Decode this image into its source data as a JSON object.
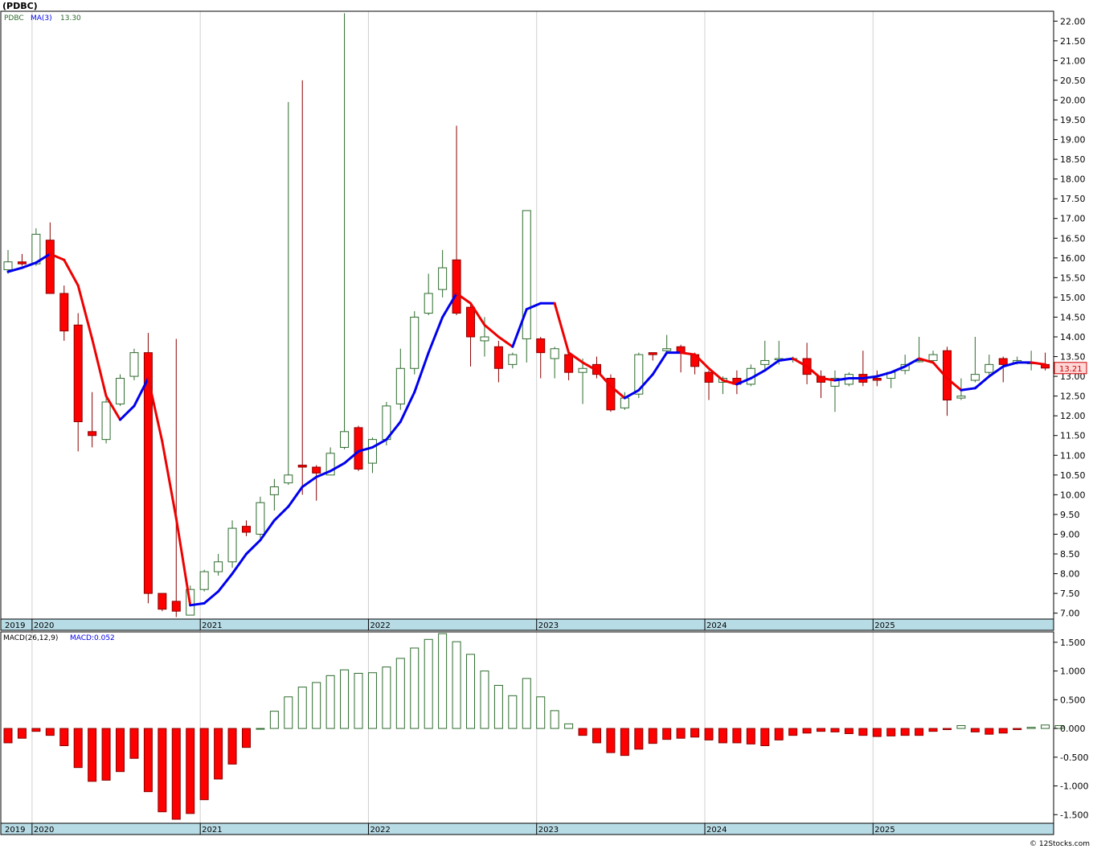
{
  "header": {
    "title": "(PDBC)",
    "symbol_label": "PDBC",
    "ma_label": "MA(3)",
    "ma_value": "13.30",
    "macd_label": "MACD(26,12,9)",
    "macd_value_label": "MACD:0.052",
    "last_price_tag": "13.21",
    "watermark": "© 12Stocks.com"
  },
  "colors": {
    "up_candle_edge": "#2e6b2e",
    "down_candle": "#ff0000",
    "ma_up": "#0000ee",
    "ma_down": "#ee0000",
    "macd_pos": "#2e6b2e",
    "macd_neg": "#ff0000",
    "axis_strip": "#b8dce6",
    "grid": "#d0d0d0"
  },
  "chart_data": [
    {
      "type": "candlestick",
      "name": "price",
      "interval": "monthly",
      "start": "2019-11",
      "ylim": [
        6.85,
        22.25
      ],
      "y_ticks": [
        "7.00",
        "7.50",
        "8.00",
        "8.50",
        "9.00",
        "9.50",
        "10.00",
        "10.50",
        "11.00",
        "11.50",
        "12.00",
        "12.50",
        "13.00",
        "13.50",
        "14.00",
        "14.50",
        "15.00",
        "15.50",
        "16.00",
        "16.50",
        "17.00",
        "17.50",
        "18.00",
        "18.50",
        "19.00",
        "19.50",
        "20.00",
        "20.50",
        "21.00",
        "21.50",
        "22.00"
      ],
      "x_labels": [
        "2019",
        "2020",
        "2021",
        "2022",
        "2023",
        "2024",
        "2025"
      ],
      "ohlc": [
        [
          15.7,
          16.2,
          15.6,
          15.9
        ],
        [
          15.9,
          16.1,
          15.8,
          15.85
        ],
        [
          15.85,
          16.75,
          15.8,
          16.6
        ],
        [
          16.45,
          16.9,
          15.1,
          15.1
        ],
        [
          15.1,
          15.3,
          13.9,
          14.15
        ],
        [
          14.3,
          14.6,
          11.1,
          11.85
        ],
        [
          11.6,
          12.6,
          11.2,
          11.5
        ],
        [
          11.4,
          12.45,
          11.3,
          12.35
        ],
        [
          12.3,
          13.05,
          12.25,
          12.95
        ],
        [
          13.0,
          13.7,
          12.9,
          13.6
        ],
        [
          13.6,
          14.1,
          7.25,
          7.5
        ],
        [
          7.5,
          7.5,
          7.05,
          7.1
        ],
        [
          7.3,
          13.95,
          6.9,
          7.05
        ],
        [
          6.95,
          7.7,
          6.95,
          7.6
        ],
        [
          7.6,
          8.1,
          7.55,
          8.05
        ],
        [
          8.05,
          8.5,
          7.95,
          8.3
        ],
        [
          8.3,
          9.35,
          8.15,
          9.15
        ],
        [
          9.2,
          9.35,
          8.95,
          9.05
        ],
        [
          9.0,
          9.95,
          8.9,
          9.8
        ],
        [
          10.0,
          10.4,
          9.6,
          10.2
        ],
        [
          10.3,
          19.95,
          10.25,
          10.5
        ],
        [
          10.75,
          20.5,
          10.0,
          10.7
        ],
        [
          10.7,
          10.75,
          9.85,
          10.55
        ],
        [
          10.5,
          11.2,
          10.5,
          11.05
        ],
        [
          11.2,
          22.2,
          11.15,
          11.6
        ],
        [
          11.7,
          11.75,
          10.6,
          10.65
        ],
        [
          10.8,
          11.45,
          10.55,
          11.4
        ],
        [
          11.4,
          12.35,
          11.25,
          12.25
        ],
        [
          12.3,
          13.7,
          12.15,
          13.2
        ],
        [
          13.2,
          14.65,
          13.05,
          14.5
        ],
        [
          14.6,
          15.6,
          14.55,
          15.1
        ],
        [
          15.2,
          16.2,
          15.0,
          15.75
        ],
        [
          15.95,
          19.35,
          14.55,
          14.6
        ],
        [
          14.75,
          14.85,
          13.25,
          14.0
        ],
        [
          13.9,
          14.5,
          13.5,
          14.0
        ],
        [
          13.75,
          13.9,
          12.85,
          13.2
        ],
        [
          13.3,
          13.6,
          13.2,
          13.55
        ],
        [
          13.95,
          17.2,
          13.35,
          17.2
        ],
        [
          13.95,
          14.0,
          12.95,
          13.6
        ],
        [
          13.45,
          13.75,
          12.95,
          13.7
        ],
        [
          13.55,
          13.6,
          12.9,
          13.1
        ],
        [
          13.1,
          13.45,
          12.3,
          13.2
        ],
        [
          13.3,
          13.5,
          12.95,
          13.05
        ],
        [
          12.95,
          13.05,
          12.1,
          12.15
        ],
        [
          12.2,
          12.6,
          12.15,
          12.45
        ],
        [
          12.55,
          13.6,
          12.45,
          13.55
        ],
        [
          13.6,
          13.6,
          13.4,
          13.55
        ],
        [
          13.65,
          14.05,
          13.55,
          13.7
        ],
        [
          13.75,
          13.8,
          13.1,
          13.6
        ],
        [
          13.55,
          13.6,
          13.05,
          13.25
        ],
        [
          13.1,
          13.15,
          12.4,
          12.85
        ],
        [
          12.85,
          13.0,
          12.55,
          12.95
        ],
        [
          12.95,
          13.15,
          12.55,
          12.8
        ],
        [
          12.8,
          13.3,
          12.75,
          13.2
        ],
        [
          13.3,
          13.9,
          13.15,
          13.4
        ],
        [
          13.45,
          13.9,
          13.3,
          13.45
        ],
        [
          13.45,
          13.5,
          13.35,
          13.45
        ],
        [
          13.45,
          13.85,
          12.8,
          13.05
        ],
        [
          13.0,
          13.15,
          12.45,
          12.85
        ],
        [
          12.75,
          13.15,
          12.1,
          12.95
        ],
        [
          12.8,
          13.1,
          12.75,
          13.05
        ],
        [
          13.05,
          13.65,
          12.75,
          12.85
        ],
        [
          12.95,
          13.15,
          12.75,
          12.9
        ],
        [
          12.95,
          13.1,
          12.7,
          13.1
        ],
        [
          13.15,
          13.55,
          13.05,
          13.3
        ],
        [
          13.4,
          14.0,
          13.35,
          13.4
        ],
        [
          13.4,
          13.65,
          13.35,
          13.55
        ],
        [
          13.65,
          13.75,
          12.0,
          12.4
        ],
        [
          12.45,
          12.95,
          12.4,
          12.5
        ],
        [
          12.9,
          14.0,
          12.85,
          13.05
        ],
        [
          13.1,
          13.55,
          13.0,
          13.3
        ],
        [
          13.45,
          13.5,
          12.85,
          13.3
        ],
        [
          13.35,
          13.5,
          13.3,
          13.4
        ],
        [
          13.35,
          13.65,
          13.15,
          13.35
        ],
        [
          13.3,
          13.6,
          13.15,
          13.21
        ]
      ],
      "ma3": [
        15.65,
        15.75,
        15.88,
        16.1,
        15.95,
        15.3,
        13.95,
        12.5,
        11.9,
        12.25,
        12.95,
        11.35,
        9.4,
        7.2,
        7.25,
        7.55,
        8.0,
        8.5,
        8.85,
        9.35,
        9.7,
        10.2,
        10.45,
        10.6,
        10.8,
        11.1,
        11.2,
        11.4,
        11.85,
        12.6,
        13.6,
        14.5,
        15.1,
        14.85,
        14.3,
        14.0,
        13.75,
        14.7,
        14.85,
        14.85,
        13.6,
        13.35,
        13.15,
        12.75,
        12.45,
        12.65,
        13.05,
        13.6,
        13.6,
        13.55,
        13.2,
        12.9,
        12.8,
        12.95,
        13.15,
        13.4,
        13.45,
        13.25,
        12.95,
        12.9,
        12.95,
        12.95,
        13.0,
        13.1,
        13.25,
        13.45,
        13.35,
        12.95,
        12.65,
        12.7,
        13.0,
        13.25,
        13.35,
        13.35,
        13.3
      ],
      "ma3_current": 13.3
    },
    {
      "type": "bar",
      "name": "MACD(26,12,9)",
      "ylim": [
        -1.65,
        1.68
      ],
      "y_ticks": [
        "1.500",
        "1.000",
        "0.500",
        "0.000",
        "-0.500",
        "-1.000",
        "-1.500"
      ],
      "x_labels": [
        "2019",
        "2020",
        "2021",
        "2022",
        "2023",
        "2024",
        "2025"
      ],
      "values": [
        -0.25,
        -0.17,
        -0.05,
        -0.12,
        -0.3,
        -0.68,
        -0.92,
        -0.9,
        -0.75,
        -0.52,
        -1.1,
        -1.45,
        -1.58,
        -1.48,
        -1.24,
        -0.88,
        -0.62,
        -0.33,
        0.0,
        0.3,
        0.55,
        0.72,
        0.8,
        0.92,
        1.02,
        0.96,
        0.97,
        1.07,
        1.22,
        1.4,
        1.55,
        1.65,
        1.51,
        1.29,
        1.0,
        0.75,
        0.57,
        0.87,
        0.55,
        0.31,
        0.08,
        -0.12,
        -0.25,
        -0.42,
        -0.47,
        -0.36,
        -0.26,
        -0.19,
        -0.17,
        -0.15,
        -0.2,
        -0.25,
        -0.25,
        -0.27,
        -0.3,
        -0.2,
        -0.12,
        -0.08,
        -0.05,
        -0.06,
        -0.09,
        -0.12,
        -0.14,
        -0.13,
        -0.12,
        -0.12,
        -0.05,
        -0.02,
        0.05,
        -0.06,
        -0.1,
        -0.08,
        -0.02,
        0.02,
        0.06,
        0.05
      ],
      "current": 0.052
    }
  ]
}
